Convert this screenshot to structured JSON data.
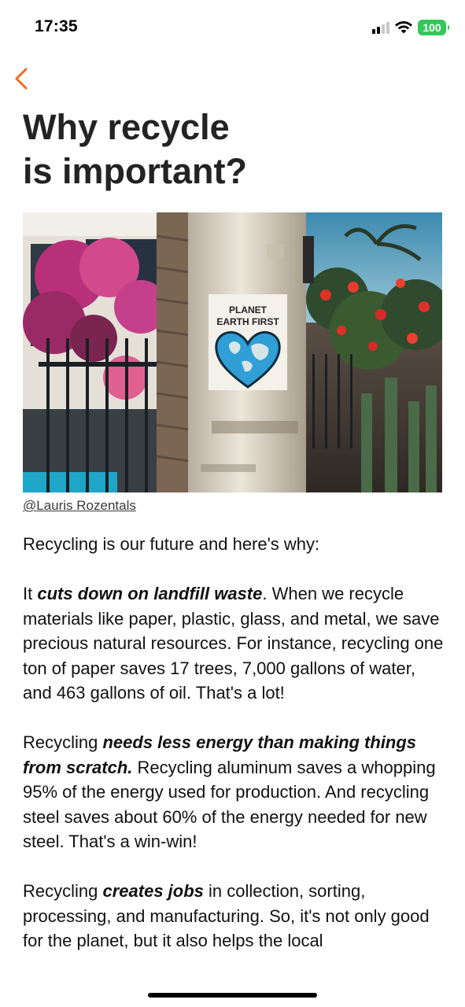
{
  "status_bar": {
    "time": "17:35",
    "battery": "100",
    "icons": [
      "cellular-signal-icon",
      "wifi-icon",
      "battery-icon"
    ]
  },
  "nav": {
    "back_icon": "chevron-left-icon",
    "accent_color": "#f26b1d"
  },
  "article": {
    "title_line1": "Why recycle",
    "title_line2": "is important?",
    "image": {
      "sign_line1": "PLANET",
      "sign_line2": "EARTH FIRST"
    },
    "photo_credit": "@Lauris Rozentals",
    "intro": "Recycling is our future and here's why:",
    "p1": {
      "before": "It ",
      "emphasis": "cuts down on landfill waste",
      "after": ". When we recycle materials like paper, plastic, glass, and metal, we save precious natural resources. For instance, recycling one ton of paper saves 17 trees, 7,000 gallons of water, and 463 gallons of oil. That's a lot!"
    },
    "p2": {
      "before": "Recycling ",
      "emphasis": "needs less energy than making things from scratch.",
      "after": " Recycling aluminum saves a whopping 95% of the energy used for production. And recycling steel saves about 60% of the energy needed for new steel. That's a win-win!"
    },
    "p3": {
      "before": "Recycling ",
      "emphasis": "creates jobs",
      "after": " in collection, sorting, processing, and manufacturing. So, it's not only good for the planet, but it also helps the local"
    }
  }
}
